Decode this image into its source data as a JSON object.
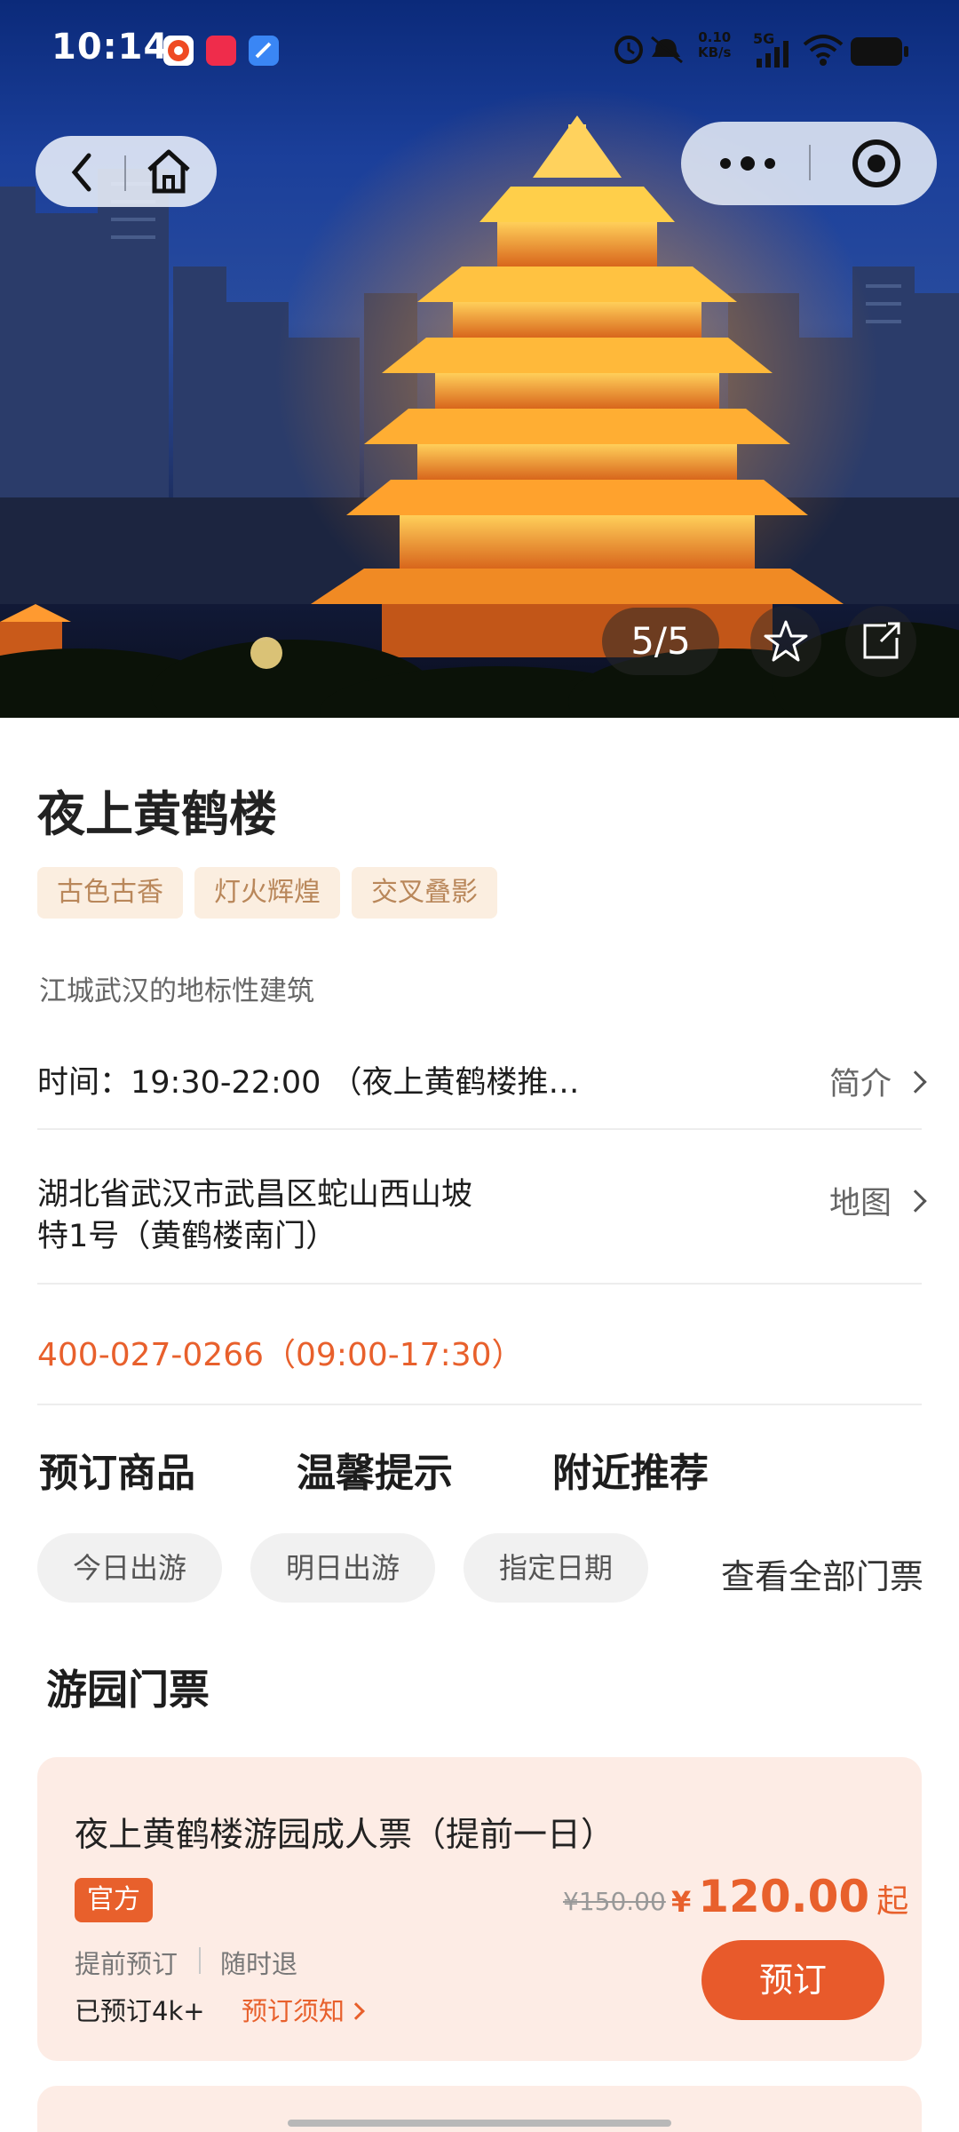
{
  "status_bar": {
    "time": "10:14",
    "net_rate_value": "0.10",
    "net_rate_unit": "KB/s",
    "network": "5G"
  },
  "hero": {
    "photo": "黄鹤楼夜景",
    "counter": "5/5"
  },
  "attraction": {
    "title": "夜上黄鹤楼",
    "tags": [
      "古色古香",
      "灯火辉煌",
      "交叉叠影"
    ],
    "subtitle": "江城武汉的地标性建筑",
    "time_text": "时间：19:30-22:00 （夜上黄鹤楼推…",
    "intro_link": "简介",
    "address_line1": "湖北省武汉市武昌区蛇山西山坡",
    "address_line2": "特1号（黄鹤楼南门）",
    "map_link": "地图",
    "phone": "400-027-0266（09:00-17:30）"
  },
  "tabs": [
    "预订商品",
    "温馨提示",
    "附近推荐"
  ],
  "date_chips": [
    "今日出游",
    "明日出游",
    "指定日期"
  ],
  "view_all": "查看全部门票",
  "section_title": "游园门票",
  "ticket": {
    "name": "夜上黄鹤楼游园成人票（提前一日）",
    "badge": "官方",
    "features": [
      "提前预订",
      "随时退"
    ],
    "booked": "已预订4k+",
    "notice": "预订须知",
    "original_price": "¥150.00",
    "currency": "¥",
    "price": "120.00",
    "price_suffix": "起",
    "book_button": "预订"
  },
  "colors": {
    "accent": "#e8602c",
    "tag_bg": "#fbeee0",
    "tag_text": "#b9875a",
    "card_bg": "#fdece5"
  }
}
